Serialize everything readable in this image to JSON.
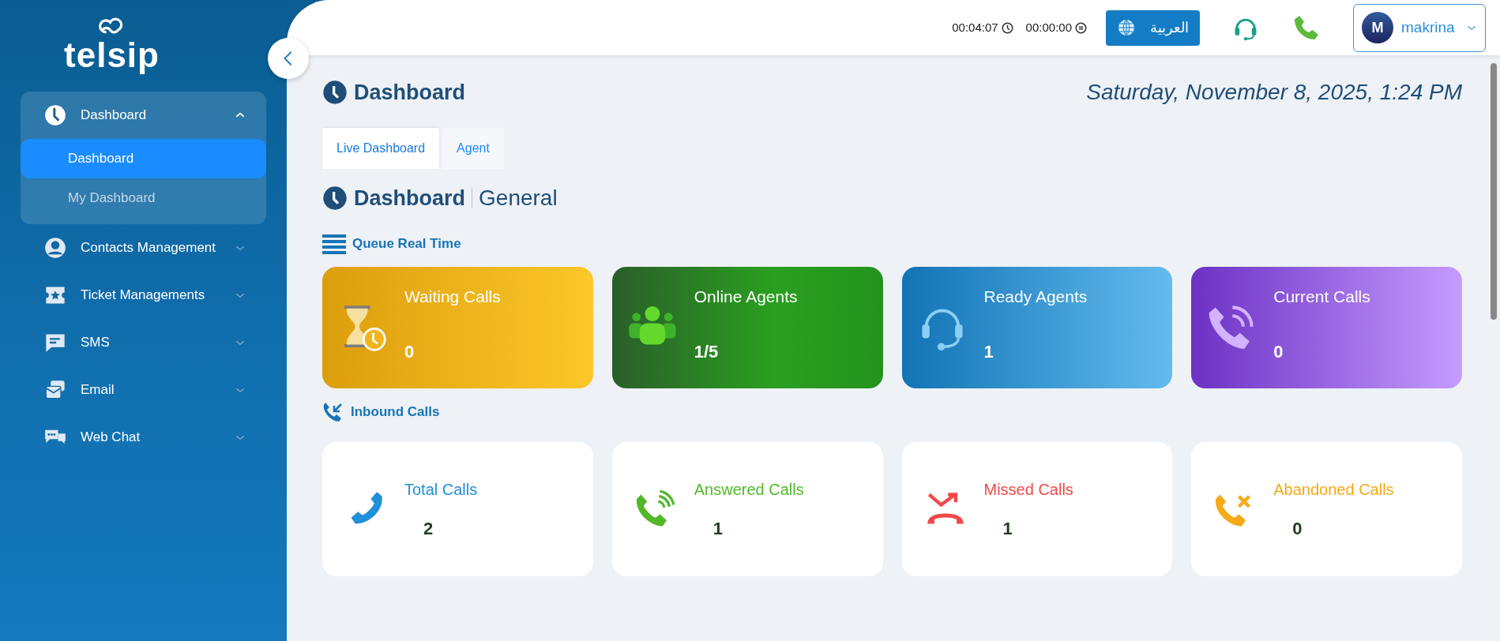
{
  "logo": {
    "text": "telsip"
  },
  "sidebar": {
    "items": [
      {
        "kind": "clock",
        "label": "Dashboard",
        "expanded": true,
        "children": [
          {
            "label": "Dashboard",
            "selected": true
          },
          {
            "label": "My Dashboard",
            "selected": false
          }
        ]
      },
      {
        "kind": "person",
        "label": "Contacts Management",
        "expanded": false
      },
      {
        "kind": "ticket",
        "label": "Ticket Managements",
        "expanded": false
      },
      {
        "kind": "sms",
        "label": "SMS",
        "expanded": false
      },
      {
        "kind": "email",
        "label": "Email",
        "expanded": false
      },
      {
        "kind": "chat",
        "label": "Web Chat",
        "expanded": false
      }
    ]
  },
  "topbar": {
    "timers": [
      {
        "kind": "clock",
        "value": "00:04:07"
      },
      {
        "kind": "pause",
        "value": "00:00:00"
      }
    ],
    "language_button": "العربية",
    "user": {
      "initial": "M",
      "name": "makrina"
    }
  },
  "page": {
    "title": "Dashboard",
    "datetime": "Saturday, November 8, 2025, 1:24 PM",
    "tabs": [
      {
        "label": "Live Dashboard",
        "selected": true
      },
      {
        "label": "Agent",
        "selected": false
      }
    ],
    "section_title": "Dashboard",
    "section_subtitle": "General",
    "queue": {
      "title": "Queue Real Time",
      "cards": [
        {
          "kind": "waiting",
          "label": "Waiting Calls",
          "value": "0"
        },
        {
          "kind": "online",
          "label": "Online Agents",
          "value": "1/5"
        },
        {
          "kind": "ready",
          "label": "Ready Agents",
          "value": "1"
        },
        {
          "kind": "current",
          "label": "Current Calls",
          "value": "0"
        }
      ]
    },
    "inbound": {
      "title": "Inbound Calls",
      "cards": [
        {
          "kind": "total",
          "label": "Total Calls",
          "value": "2",
          "color": "#1e8fd8"
        },
        {
          "kind": "answered",
          "label": "Answered Calls",
          "value": "1",
          "color": "#52b82a"
        },
        {
          "kind": "missed",
          "label": "Missed Calls",
          "value": "1",
          "color": "#f04848"
        },
        {
          "kind": "abandoned",
          "label": "Abandoned Calls",
          "value": "0",
          "color": "#f5a914"
        }
      ]
    }
  }
}
